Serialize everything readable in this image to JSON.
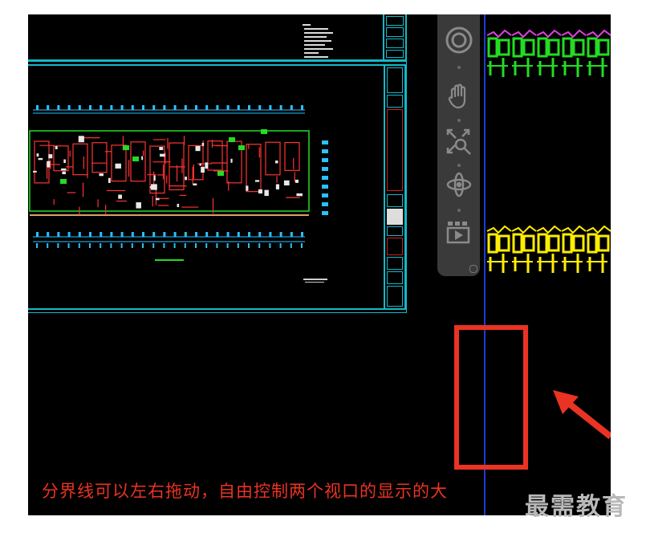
{
  "caption": {
    "text": "分界线可以左右拖动，自由控制两个视口的显示的大"
  },
  "watermark": {
    "text": "最需教育"
  },
  "navigation_bar": {
    "tools": [
      {
        "name": "steering-wheel-icon"
      },
      {
        "name": "pan-icon"
      },
      {
        "name": "zoom-icon"
      },
      {
        "name": "orbit-icon"
      },
      {
        "name": "showmotion-icon"
      }
    ]
  },
  "colors": {
    "canvas": "#000000",
    "sheet_border": "#14b8c8",
    "split_line": "#1f3ad8",
    "callout": "#ea3323",
    "plan_red": "#ff3333",
    "plan_green": "#22dd22",
    "plan_magenta": "#e040e0",
    "plan_yellow": "#ffee00"
  }
}
